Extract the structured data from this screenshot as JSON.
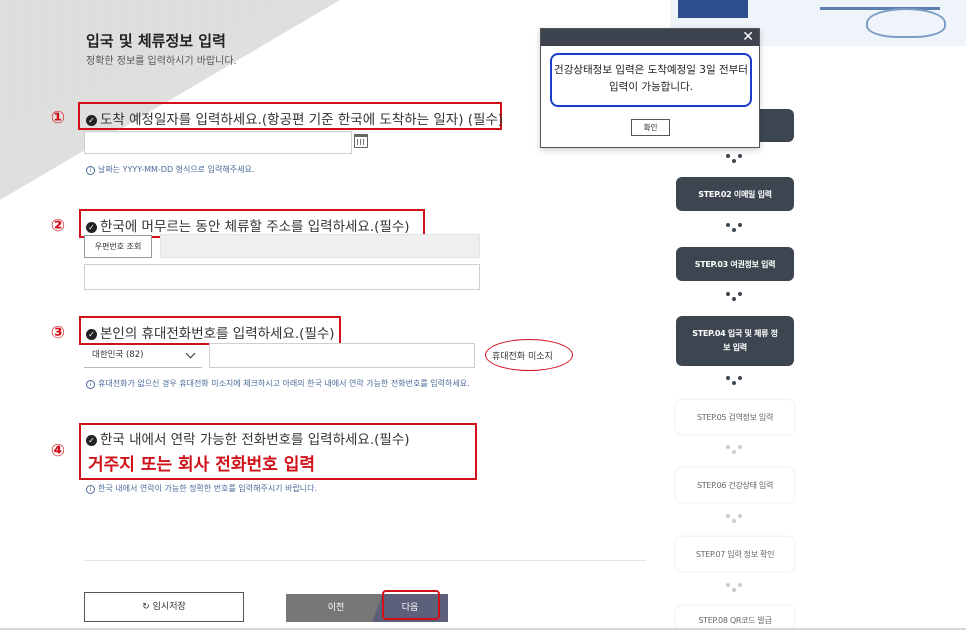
{
  "header": {
    "title": "입국 및 체류정보 입력",
    "subtitle": "정확한 정보를 입력하시기 바랍니다."
  },
  "sections": [
    {
      "num": "①",
      "label": "도착 예정일자를 입력하세요.(항공편 기준 한국에 도착하는 일자) (필수)",
      "hint": "날짜는 YYYY-MM-DD 형식으로 입력해주세요."
    },
    {
      "num": "②",
      "label": "한국에 머무르는 동안 체류할 주소를 입력하세요.(필수)",
      "postcode_button": "우편번호 조회"
    },
    {
      "num": "③",
      "label": "본인의 휴대전화번호를 입력하세요.(필수)",
      "country_select": "대한민국 (82)",
      "no_phone": "휴대전화 미소지",
      "hint": "휴대전화가 없으신 경우 휴대전화 미소지에 체크하시고 아래의 한국 내에서 연락 가능한 전화번호를 입력하세요."
    },
    {
      "num": "④",
      "label": "한국 내에서 연락 가능한 전화번호를 입력하세요.(필수)",
      "annotation": "거주지 또는 회사 전화번호 입력",
      "hint": "한국 내에서 연락이 가능한 정확한 번호를 입력해주시기 바랍니다."
    }
  ],
  "buttons": {
    "temp_save": "임시저장",
    "prev": "이전",
    "next": "다음"
  },
  "steps": [
    {
      "label": "STEP.02 이메일 입력",
      "state": "done"
    },
    {
      "label": "STEP.03 여권정보 입력",
      "state": "done"
    },
    {
      "label": "STEP.04 입국 및 체류 정보 입력",
      "state": "current"
    },
    {
      "label": "STEP.05 검역정보 입력",
      "state": "todo"
    },
    {
      "label": "STEP.06 건강상태 입력",
      "state": "todo"
    },
    {
      "label": "STEP.07 입력 정보 확인",
      "state": "todo"
    },
    {
      "label": "STEP.08 QR코드 발급",
      "state": "todo"
    }
  ],
  "modal": {
    "message": "건강상태정보 입력은 도착예정일 3일 전부터 입력이 가능합니다.",
    "ok": "확인",
    "close": "✕"
  },
  "colors": {
    "annotation_red": "#d0111a",
    "modal_highlight": "#1a3cc8",
    "step_dark": "#3d4650",
    "next_button": "#5d607a"
  }
}
